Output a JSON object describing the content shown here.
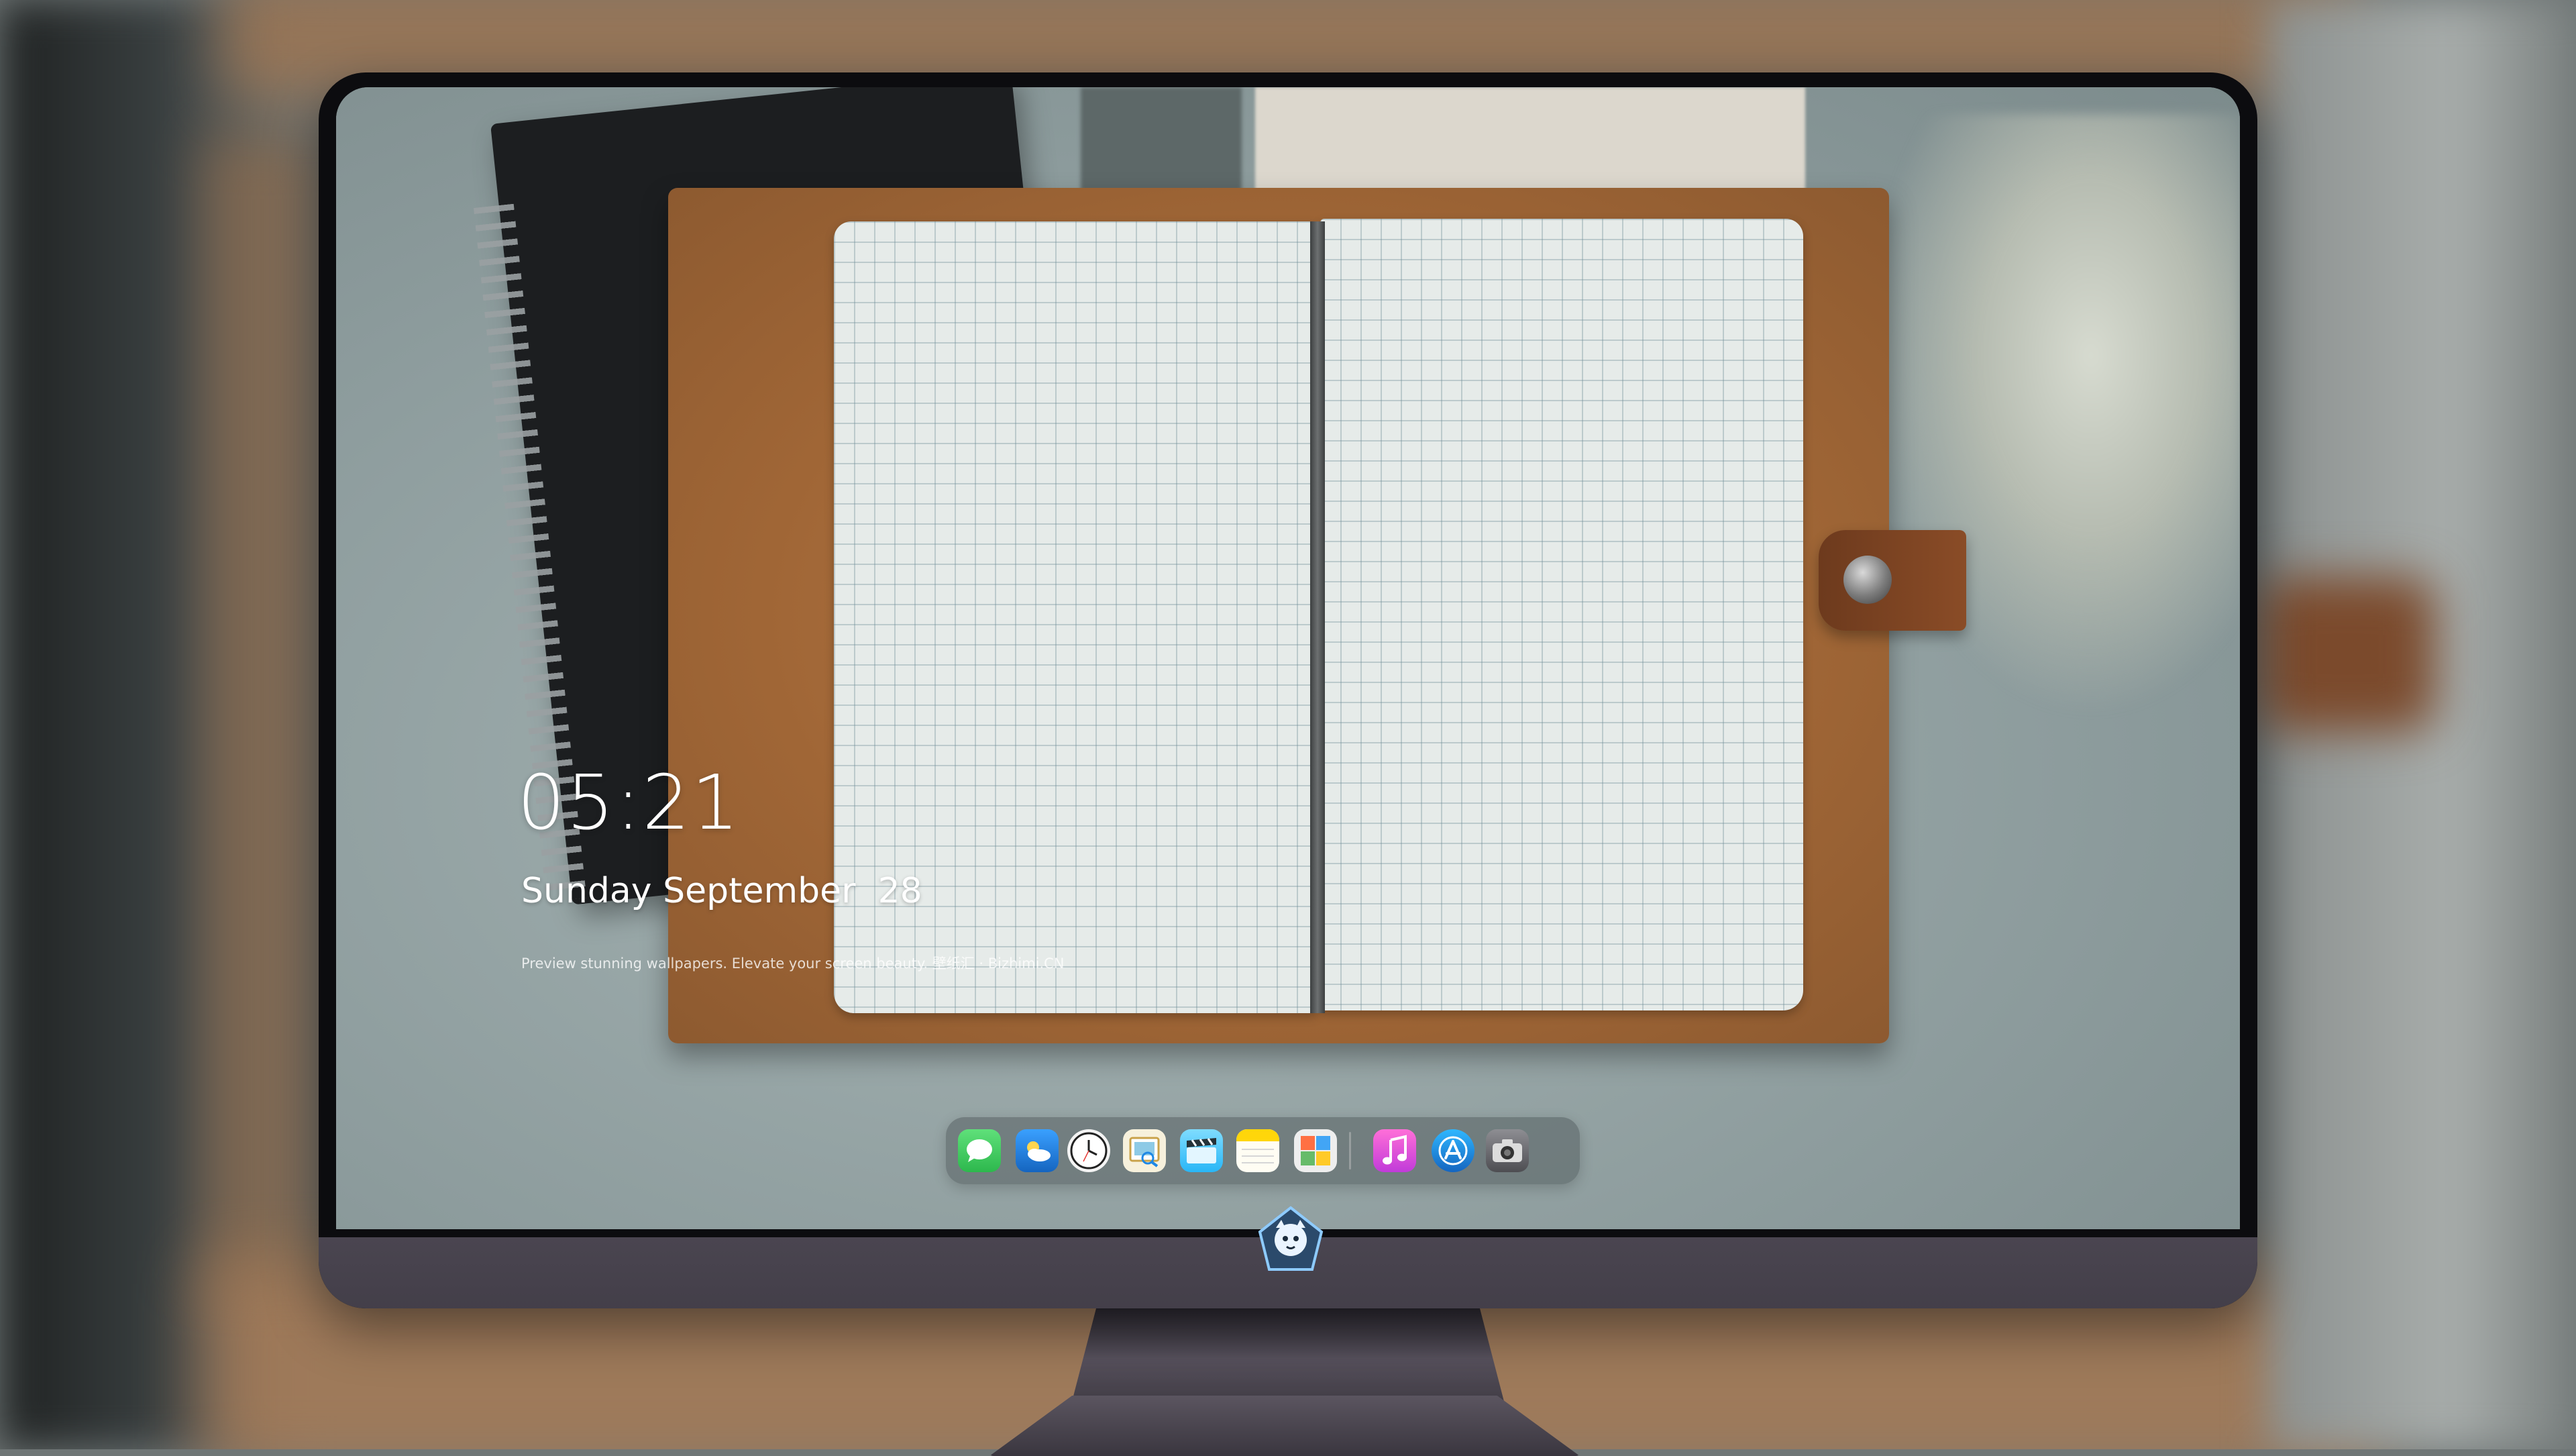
{
  "lockscreen": {
    "time": "05:21",
    "date": "Sunday September  28",
    "tagline": "Preview stunning wallpapers. Elevate your screen beauty. 壁纸汇 · Bizhimi.CN"
  },
  "dock": {
    "apps": [
      {
        "name": "Messages",
        "icon": "messages-icon",
        "color": "#34c759"
      },
      {
        "name": "Weather",
        "icon": "weather-icon",
        "color": "#1e88e5"
      },
      {
        "name": "Clock",
        "icon": "clock-icon",
        "color": "#1c1c1e"
      },
      {
        "name": "Preview",
        "icon": "preview-icon",
        "color": "#f5d36a"
      },
      {
        "name": "Clips",
        "icon": "clapperboard-icon",
        "color": "#4fc3f7"
      },
      {
        "name": "Notes",
        "icon": "notes-icon",
        "color": "#ffd60a"
      },
      {
        "name": "Photo Booth",
        "icon": "photo-grid-icon",
        "color": "#e9e9e9"
      },
      {
        "name": "iTunes",
        "icon": "music-icon",
        "color": "#e040fb"
      },
      {
        "name": "App Store",
        "icon": "app-store-icon",
        "color": "#1e88e5"
      },
      {
        "name": "Camera",
        "icon": "camera-icon",
        "color": "#6e6e73"
      }
    ]
  },
  "colors": {
    "bezel": "#0c0c0f",
    "chin": "#443f4a",
    "leather": "#a06636",
    "page": "#e6ebe9"
  }
}
